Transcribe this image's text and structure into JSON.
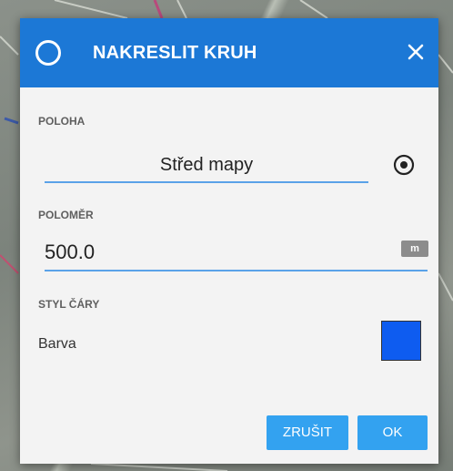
{
  "dialog": {
    "title": "NAKRESLIT KRUH",
    "header_color": "#1c78d6",
    "icons": {
      "header": "circle-outline-icon",
      "close": "close-icon",
      "target": "my-location-icon"
    }
  },
  "position": {
    "label": "POLOHA",
    "value": "Střed mapy"
  },
  "radius": {
    "label": "POLOMĚR",
    "value": "500.0",
    "unit": "m"
  },
  "line_style": {
    "label": "STYL ČÁRY",
    "color_label": "Barva",
    "color_value": "#0e5cf0"
  },
  "buttons": {
    "cancel": "ZRUŠIT",
    "ok": "OK",
    "color": "#33a2f0"
  }
}
